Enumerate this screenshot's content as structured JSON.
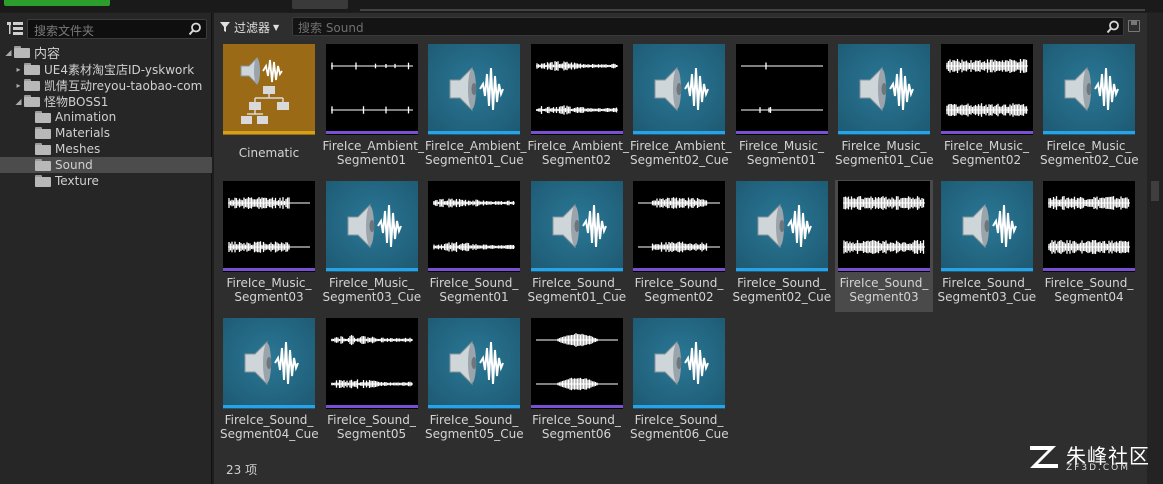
{
  "colors": {
    "panel_bg": "#2e2e2e",
    "tree_bg": "#262626",
    "cue_bg": "#1e5a73",
    "wave_bg": "#000000",
    "sound_wave_bar": "#7b4fd4",
    "sound_cue_bar": "#29a3e8",
    "cinematic_bar": "#d4a016",
    "cinematic_bg": "#9a6a16"
  },
  "folder_search": {
    "placeholder": "搜索文件夹"
  },
  "tree": {
    "root_label": "内容",
    "items": [
      {
        "label": "UE4素材淘宝店ID-yskwork",
        "level": 1,
        "arrow": "▸"
      },
      {
        "label": "凯倩互动reyou-taobao-com",
        "level": 1,
        "arrow": "▸"
      },
      {
        "label": "怪物BOSS1",
        "level": 1,
        "arrow": "◢"
      },
      {
        "label": "Animation",
        "level": 2,
        "arrow": ""
      },
      {
        "label": "Materials",
        "level": 2,
        "arrow": ""
      },
      {
        "label": "Meshes",
        "level": 2,
        "arrow": ""
      },
      {
        "label": "Sound",
        "level": 2,
        "arrow": "",
        "selected": true
      },
      {
        "label": "Texture",
        "level": 2,
        "arrow": ""
      }
    ]
  },
  "toolbar": {
    "filter_label": "过滤器",
    "search_placeholder": "搜索 Sound"
  },
  "assets": [
    {
      "line1": "Cinematic",
      "line2": "",
      "kind": "cinematic"
    },
    {
      "line1": "FireIce_Ambient_",
      "line2": "Segment01",
      "kind": "wave",
      "profile": "sparse"
    },
    {
      "line1": "FireIce_Ambient_",
      "line2": "Segment01_Cue",
      "kind": "cue"
    },
    {
      "line1": "FireIce_Ambient_",
      "line2": "Segment02",
      "kind": "wave",
      "profile": "medium"
    },
    {
      "line1": "FireIce_Ambient_",
      "line2": "Segment02_Cue",
      "kind": "cue"
    },
    {
      "line1": "FireIce_Music_",
      "line2": "Segment01",
      "kind": "wave",
      "profile": "sparse"
    },
    {
      "line1": "FireIce_Music_",
      "line2": "Segment01_Cue",
      "kind": "cue"
    },
    {
      "line1": "FireIce_Music_",
      "line2": "Segment02",
      "kind": "wave",
      "profile": "dense"
    },
    {
      "line1": "FireIce_Music_",
      "line2": "Segment02_Cue",
      "kind": "cue"
    },
    {
      "line1": "FireIce_Music_",
      "line2": "Segment03",
      "kind": "wave",
      "profile": "left"
    },
    {
      "line1": "FireIce_Music_",
      "line2": "Segment03_Cue",
      "kind": "cue"
    },
    {
      "line1": "FireIce_Sound_",
      "line2": "Segment01",
      "kind": "wave",
      "profile": "medium"
    },
    {
      "line1": "FireIce_Sound_",
      "line2": "Segment01_Cue",
      "kind": "cue"
    },
    {
      "line1": "FireIce_Sound_",
      "line2": "Segment02",
      "kind": "wave",
      "profile": "mid"
    },
    {
      "line1": "FireIce_Sound_",
      "line2": "Segment02_Cue",
      "kind": "cue"
    },
    {
      "line1": "FireIce_Sound_",
      "line2": "Segment03",
      "kind": "wave",
      "profile": "dense",
      "selected": true
    },
    {
      "line1": "FireIce_Sound_",
      "line2": "Segment03_Cue",
      "kind": "cue"
    },
    {
      "line1": "FireIce_Sound_",
      "line2": "Segment04",
      "kind": "wave",
      "profile": "dense"
    },
    {
      "line1": "FireIce_Sound_",
      "line2": "Segment04_Cue",
      "kind": "cue"
    },
    {
      "line1": "FireIce_Sound_",
      "line2": "Segment05",
      "kind": "wave",
      "profile": "medium"
    },
    {
      "line1": "FireIce_Sound_",
      "line2": "Segment05_Cue",
      "kind": "cue"
    },
    {
      "line1": "FireIce_Sound_",
      "line2": "Segment06",
      "kind": "wave",
      "profile": "blob"
    },
    {
      "line1": "FireIce_Sound_",
      "line2": "Segment06_Cue",
      "kind": "cue"
    }
  ],
  "status": {
    "item_count": "23 项"
  },
  "watermark": {
    "title": "朱峰社区",
    "sub": "ZF3D.COM"
  }
}
